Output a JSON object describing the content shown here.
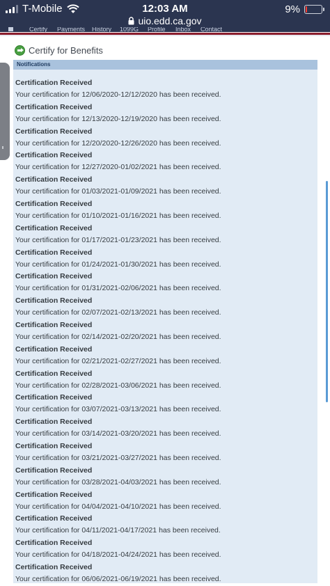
{
  "status_bar": {
    "carrier": "T-Mobile",
    "time": "12:03 AM",
    "url": "uio.edd.ca.gov",
    "battery": "9%",
    "battery_level": 0.09
  },
  "nav": {
    "items": [
      "Certify",
      "Payments",
      "History",
      "1099G",
      "Profile",
      "Inbox",
      "Contact"
    ]
  },
  "page": {
    "title": "Certify for Benefits"
  },
  "notifications": {
    "header": "Notifications",
    "items": [
      {
        "title": "Certification Received",
        "text": "Your certification for 12/06/2020-12/12/2020 has been received."
      },
      {
        "title": "Certification Received",
        "text": "Your certification for 12/13/2020-12/19/2020 has been received."
      },
      {
        "title": "Certification Received",
        "text": "Your certification for 12/20/2020-12/26/2020 has been received."
      },
      {
        "title": "Certification Received",
        "text": "Your certification for 12/27/2020-01/02/2021 has been received."
      },
      {
        "title": "Certification Received",
        "text": "Your certification for 01/03/2021-01/09/2021 has been received."
      },
      {
        "title": "Certification Received",
        "text": "Your certification for 01/10/2021-01/16/2021 has been received."
      },
      {
        "title": "Certification Received",
        "text": "Your certification for 01/17/2021-01/23/2021 has been received."
      },
      {
        "title": "Certification Received",
        "text": "Your certification for 01/24/2021-01/30/2021 has been received."
      },
      {
        "title": "Certification Received",
        "text": "Your certification for 01/31/2021-02/06/2021 has been received."
      },
      {
        "title": "Certification Received",
        "text": "Your certification for 02/07/2021-02/13/2021 has been received."
      },
      {
        "title": "Certification Received",
        "text": "Your certification for 02/14/2021-02/20/2021 has been received."
      },
      {
        "title": "Certification Received",
        "text": "Your certification for 02/21/2021-02/27/2021 has been received."
      },
      {
        "title": "Certification Received",
        "text": "Your certification for 02/28/2021-03/06/2021 has been received."
      },
      {
        "title": "Certification Received",
        "text": "Your certification for 03/07/2021-03/13/2021 has been received."
      },
      {
        "title": "Certification Received",
        "text": "Your certification for 03/14/2021-03/20/2021 has been received."
      },
      {
        "title": "Certification Received",
        "text": "Your certification for 03/21/2021-03/27/2021 has been received."
      },
      {
        "title": "Certification Received",
        "text": "Your certification for 03/28/2021-04/03/2021 has been received."
      },
      {
        "title": "Certification Received",
        "text": "Your certification for 04/04/2021-04/10/2021 has been received."
      },
      {
        "title": "Certification Received",
        "text": "Your certification for 04/11/2021-04/17/2021 has been received."
      },
      {
        "title": "Certification Received",
        "text": "Your certification for 04/18/2021-04/24/2021 has been received."
      },
      {
        "title": "Certification Received",
        "text": "Your certification for 06/06/2021-06/19/2021 has been received."
      }
    ]
  }
}
